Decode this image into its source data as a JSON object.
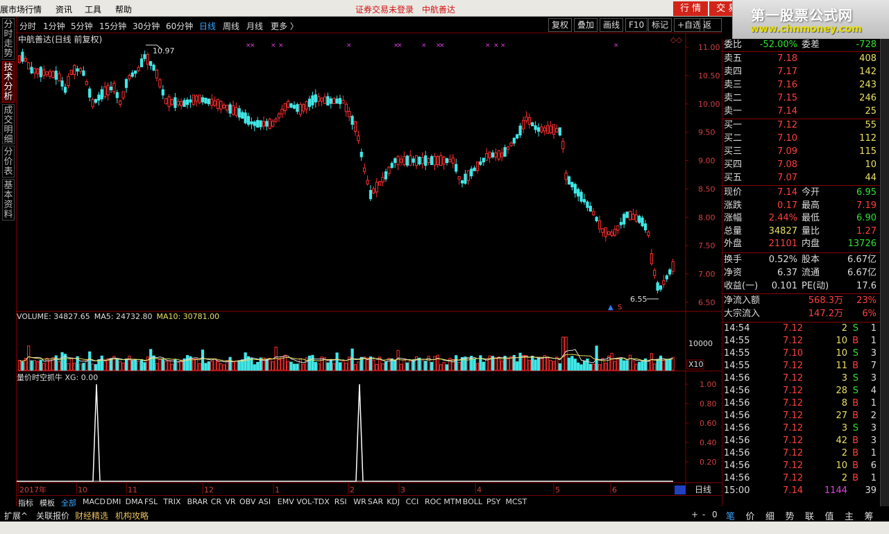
{
  "menu": {
    "items": [
      "展市场行情",
      "资讯",
      "工具",
      "帮助"
    ],
    "warning": "证券交易未登录",
    "stock_name": "中航善达",
    "trade_buttons": [
      "行 情",
      "交 易"
    ]
  },
  "logo": {
    "line1": "第一股票公式网",
    "line2": "www.chnmoney.com"
  },
  "left_tabs": [
    "分时走势",
    "技术分析",
    "成交明细",
    "分价表",
    "基本资料"
  ],
  "toolbar": {
    "periods": [
      "分时",
      "1分钟",
      "5分钟",
      "15分钟",
      "30分钟",
      "60分钟",
      "日线",
      "周线",
      "月线",
      "更多 〉"
    ],
    "active": "日线",
    "right_buttons": [
      "复权",
      "叠加",
      "画线",
      "F10",
      "标记",
      "+自选",
      "返回"
    ]
  },
  "chart": {
    "title": "中航善达(日线 前复权)",
    "high_label": "10.97",
    "low_label": "6.55",
    "price_ticks": [
      "11.00",
      "10.50",
      "10.00",
      "9.50",
      "9.00",
      "8.50",
      "8.00",
      "7.50",
      "7.00",
      "6.50"
    ],
    "volume": {
      "label_name": "VOLUME: 34827.65",
      "label_ma5": "MA5: 24732.80",
      "label_ma10": "MA10: 30781.00",
      "tick": "10000",
      "unit": "X10"
    },
    "indicator": {
      "label": "量价时空抓牛  XG: 0.00",
      "ticks": [
        "1.00",
        "0.80",
        "0.60",
        "0.40",
        "0.20"
      ]
    },
    "x_labels": [
      "2017年",
      "10",
      "11",
      "12",
      "1",
      "2",
      "3",
      "4",
      "5",
      "6"
    ],
    "period_btn": "日线",
    "zoom": [
      "+",
      "-",
      "0"
    ]
  },
  "chart_data": {
    "type": "candlestick",
    "price_range": [
      6.4,
      11.1
    ],
    "max_high": 10.97,
    "min_low": 6.55,
    "xg_peaks": [
      1,
      1
    ]
  },
  "quote": {
    "weibi": {
      "label": "委比",
      "value": "-52.00%",
      "label2": "委差",
      "value2": "-728"
    },
    "sells": [
      {
        "label": "卖五",
        "price": "7.18",
        "vol": "408"
      },
      {
        "label": "卖四",
        "price": "7.17",
        "vol": "142"
      },
      {
        "label": "卖三",
        "price": "7.16",
        "vol": "243"
      },
      {
        "label": "卖二",
        "price": "7.15",
        "vol": "246"
      },
      {
        "label": "卖一",
        "price": "7.14",
        "vol": "25"
      }
    ],
    "buys": [
      {
        "label": "买一",
        "price": "7.12",
        "vol": "55"
      },
      {
        "label": "买二",
        "price": "7.10",
        "vol": "112"
      },
      {
        "label": "买三",
        "price": "7.09",
        "vol": "115"
      },
      {
        "label": "买四",
        "price": "7.08",
        "vol": "10"
      },
      {
        "label": "买五",
        "price": "7.07",
        "vol": "44"
      }
    ],
    "stats": [
      {
        "l1": "现价",
        "v1": "7.14",
        "c1": "#ff4040",
        "l2": "今开",
        "v2": "6.95",
        "c2": "#30e030"
      },
      {
        "l1": "涨跌",
        "v1": "0.17",
        "c1": "#ff4040",
        "l2": "最高",
        "v2": "7.19",
        "c2": "#ff4040"
      },
      {
        "l1": "涨幅",
        "v1": "2.44%",
        "c1": "#ff4040",
        "l2": "最低",
        "v2": "6.90",
        "c2": "#30e030"
      },
      {
        "l1": "总量",
        "v1": "34827",
        "c1": "#e8e060",
        "l2": "量比",
        "v2": "1.27",
        "c2": "#ff4040"
      },
      {
        "l1": "外盘",
        "v1": "21101",
        "c1": "#ff4040",
        "l2": "内盘",
        "v2": "13726",
        "c2": "#30e030"
      }
    ],
    "stats2": [
      {
        "l1": "换手",
        "v1": "0.52%",
        "l2": "股本",
        "v2": "6.67亿"
      },
      {
        "l1": "净资",
        "v1": "6.37",
        "l2": "流通",
        "v2": "6.67亿"
      },
      {
        "l1": "收益(一)",
        "v1": "0.101",
        "l2": "PE(动)",
        "v2": "17.6"
      }
    ],
    "flows": [
      {
        "label": "净流入额",
        "value": "568.3万",
        "pct": "23%"
      },
      {
        "label": "大宗流入",
        "value": "147.2万",
        "pct": "6%"
      }
    ],
    "ticks": [
      {
        "t": "14:54",
        "p": "7.12",
        "v": "2",
        "d": "S",
        "n": "1"
      },
      {
        "t": "14:55",
        "p": "7.12",
        "v": "10",
        "d": "B",
        "n": "1"
      },
      {
        "t": "14:55",
        "p": "7.10",
        "v": "10",
        "d": "S",
        "n": "3"
      },
      {
        "t": "14:55",
        "p": "7.12",
        "v": "11",
        "d": "B",
        "n": "7"
      },
      {
        "t": "14:56",
        "p": "7.12",
        "v": "3",
        "d": "S",
        "n": "3"
      },
      {
        "t": "14:56",
        "p": "7.12",
        "v": "28",
        "d": "S",
        "n": "4"
      },
      {
        "t": "14:56",
        "p": "7.12",
        "v": "8",
        "d": "B",
        "n": "1"
      },
      {
        "t": "14:56",
        "p": "7.12",
        "v": "27",
        "d": "B",
        "n": "2"
      },
      {
        "t": "14:56",
        "p": "7.12",
        "v": "3",
        "d": "S",
        "n": "3"
      },
      {
        "t": "14:56",
        "p": "7.12",
        "v": "42",
        "d": "B",
        "n": "3"
      },
      {
        "t": "14:56",
        "p": "7.12",
        "v": "2",
        "d": "B",
        "n": "1"
      },
      {
        "t": "14:56",
        "p": "7.12",
        "v": "10",
        "d": "B",
        "n": "6"
      },
      {
        "t": "14:56",
        "p": "7.12",
        "v": "2",
        "d": "B",
        "n": "1"
      },
      {
        "t": "15:00",
        "p": "7.14",
        "v": "1144",
        "d": "",
        "n": "39"
      }
    ]
  },
  "indicator_tabs": [
    "指标",
    "模板",
    "全部",
    "MACD",
    "DMI",
    "DMA",
    "FSL",
    "TRIX",
    "BRAR",
    "CR",
    "VR",
    "OBV",
    "ASI",
    "EMV",
    "VOL-TDX",
    "RSI",
    "WR",
    "SAR",
    "KDJ",
    "CCI",
    "ROC",
    "MTM",
    "BOLL",
    "PSY",
    "MCST"
  ],
  "status_tabs": [
    "扩展^",
    "关联报价",
    "财经精选",
    "机构攻略"
  ],
  "bottom_tabs": [
    "笔",
    "价",
    "细",
    "势",
    "联",
    "值",
    "主",
    "筹"
  ]
}
